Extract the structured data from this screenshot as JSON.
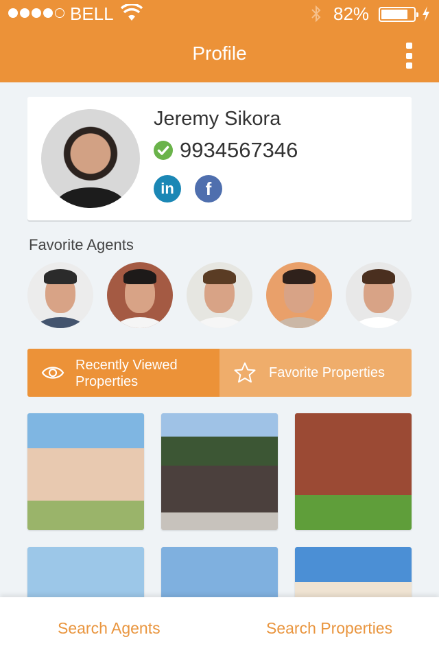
{
  "status_bar": {
    "signal_bars_filled": 4,
    "signal_bars_total": 5,
    "carrier": "BELL",
    "wifi_icon": "wifi-icon",
    "bluetooth_icon": "bluetooth-icon",
    "battery_percent": "82%",
    "battery_level": 0.82,
    "charging_icon": "charging-bolt-icon"
  },
  "header": {
    "title": "Profile",
    "menu_icon": "more-vertical-icon"
  },
  "profile": {
    "name": "Jeremy Sikora",
    "phone": "9934567346",
    "verified": true,
    "social": [
      {
        "name": "LinkedIn",
        "glyph": "in",
        "color": "#1b87b5"
      },
      {
        "name": "Facebook",
        "glyph": "f",
        "color": "#4f6fae"
      }
    ]
  },
  "favorite_agents": {
    "title": "Favorite Agents",
    "agents": [
      {
        "id": "agent-1",
        "bg": "#ececec",
        "hair": "#2b2b2b",
        "body": "#43546e"
      },
      {
        "id": "agent-2",
        "bg": "#a45a43",
        "hair": "#1d1a19",
        "body": "#f5f5f5"
      },
      {
        "id": "agent-3",
        "bg": "#e6e6e1",
        "hair": "#5a3c24",
        "body": "#f6f6f6"
      },
      {
        "id": "agent-4",
        "bg": "#e9a06a",
        "hair": "#2f211b",
        "body": "#cbb7a6"
      },
      {
        "id": "agent-5",
        "bg": "#e8e8e8",
        "hair": "#4a2f1f",
        "body": "#ffffff"
      }
    ]
  },
  "property_tabs": {
    "active": "Recently Viewed Properties",
    "items": [
      {
        "label": "Recently Viewed Properties",
        "icon": "eye-icon",
        "active": true
      },
      {
        "label": "Favorite Properties",
        "icon": "star-icon",
        "active": false
      }
    ]
  },
  "properties": [
    {
      "id": "property-1",
      "type": "house"
    },
    {
      "id": "property-2",
      "type": "house"
    },
    {
      "id": "property-3",
      "type": "apartment"
    },
    {
      "id": "property-4",
      "type": "house"
    },
    {
      "id": "property-5",
      "type": "house"
    },
    {
      "id": "property-6",
      "type": "house"
    }
  ],
  "bottom_tabs": [
    {
      "label": "Search Agents"
    },
    {
      "label": "Search Properties"
    }
  ],
  "colors": {
    "primary": "#ec9238",
    "primary_light": "#efad6b",
    "verified_green": "#6ab34a",
    "linkedin": "#1b87b5",
    "facebook": "#4f6fae",
    "background": "#eff3f6"
  }
}
